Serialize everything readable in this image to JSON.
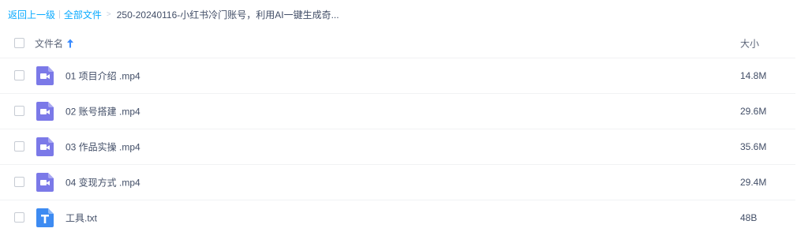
{
  "breadcrumb": {
    "back_label": "返回上一级",
    "separator": "|",
    "all_files_label": "全部文件",
    "arrow": ">",
    "current_folder": "250-20240116-小红书冷门账号，利用AI一键生成奇..."
  },
  "table": {
    "header": {
      "name_label": "文件名",
      "size_label": "大小",
      "sort_icon": "arrow-up-icon",
      "sort_color": "#3b8cff"
    },
    "rows": [
      {
        "name": "01 项目介绍 .mp4",
        "size": "14.8M",
        "icon": "video-file-icon"
      },
      {
        "name": "02 账号搭建 .mp4",
        "size": "29.6M",
        "icon": "video-file-icon"
      },
      {
        "name": "03 作品实操 .mp4",
        "size": "35.6M",
        "icon": "video-file-icon"
      },
      {
        "name": "04 变现方式 .mp4",
        "size": "29.4M",
        "icon": "video-file-icon"
      },
      {
        "name": "工具.txt",
        "size": "48B",
        "icon": "text-file-icon"
      }
    ]
  },
  "colors": {
    "link": "#09aaff",
    "video_icon": "#7b79e8",
    "text_icon": "#3d8bf2"
  }
}
